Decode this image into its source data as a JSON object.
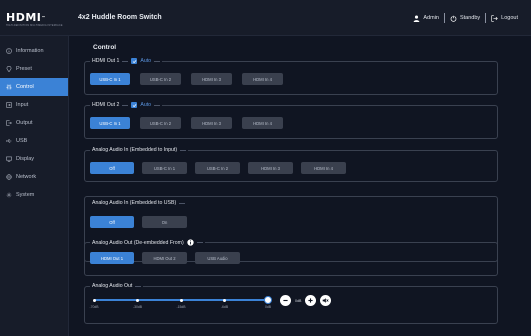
{
  "header": {
    "logo_text": "HDMI",
    "logo_tm": "™",
    "logo_tagline": "HIGH-DEFINITION MULTIMEDIA INTERFACE",
    "title": "4x2 Huddle Room Switch",
    "user_label": "Admin",
    "standby_label": "Standby",
    "logout_label": "Logout"
  },
  "sidebar": {
    "items": [
      {
        "label": "Information",
        "icon": "info-icon"
      },
      {
        "label": "Preset",
        "icon": "pin-icon"
      },
      {
        "label": "Control",
        "icon": "sliders-icon"
      },
      {
        "label": "Input",
        "icon": "input-icon"
      },
      {
        "label": "Output",
        "icon": "output-icon"
      },
      {
        "label": "USB",
        "icon": "usb-icon"
      },
      {
        "label": "Display",
        "icon": "monitor-icon"
      },
      {
        "label": "Network",
        "icon": "globe-icon"
      },
      {
        "label": "System",
        "icon": "gear-icon"
      }
    ],
    "active": "Control"
  },
  "main": {
    "title": "Control",
    "hdmi_out_1": {
      "legend": "HDMI Out 1",
      "auto_label": "Auto",
      "buttons": [
        "USB-C In 1",
        "USB-C In 2",
        "HDMI In 3",
        "HDMI In 4"
      ],
      "selected": "USB-C In 1"
    },
    "hdmi_out_2": {
      "legend": "HDMI Out 2",
      "auto_label": "Auto",
      "buttons": [
        "USB-C In 1",
        "USB-C In 2",
        "HDMI In 3",
        "HDMI In 4"
      ],
      "selected": "USB-C In 1"
    },
    "analog_in_input": {
      "legend": "Analog Audio In (Embedded to Input)",
      "buttons": [
        "Off",
        "USB-C In 1",
        "USB-C In 2",
        "HDMI In 3",
        "HDMI In 4"
      ],
      "selected": "Off"
    },
    "analog_in_usb": {
      "legend": "Analog Audio In (Embedded to USB)",
      "buttons": [
        "Off",
        "On"
      ],
      "selected": "Off"
    },
    "analog_out_deembedded": {
      "legend": "Analog Audio Out (De-embedded From)",
      "buttons": [
        "HDMI Out 1",
        "HDMI Out 2",
        "USB Audio"
      ],
      "selected": "HDMI Out 1"
    },
    "analog_out": {
      "legend": "Analog Audio Out",
      "ticks": [
        "-70dB",
        "-30dB",
        "-15dB",
        "-6dB",
        "0dB"
      ],
      "value_label": "0dB",
      "value_fraction": 1.0
    }
  },
  "colors": {
    "accent": "#3b82d6",
    "background": "#101522",
    "panel": "#171c29",
    "button": "#3a404e"
  }
}
